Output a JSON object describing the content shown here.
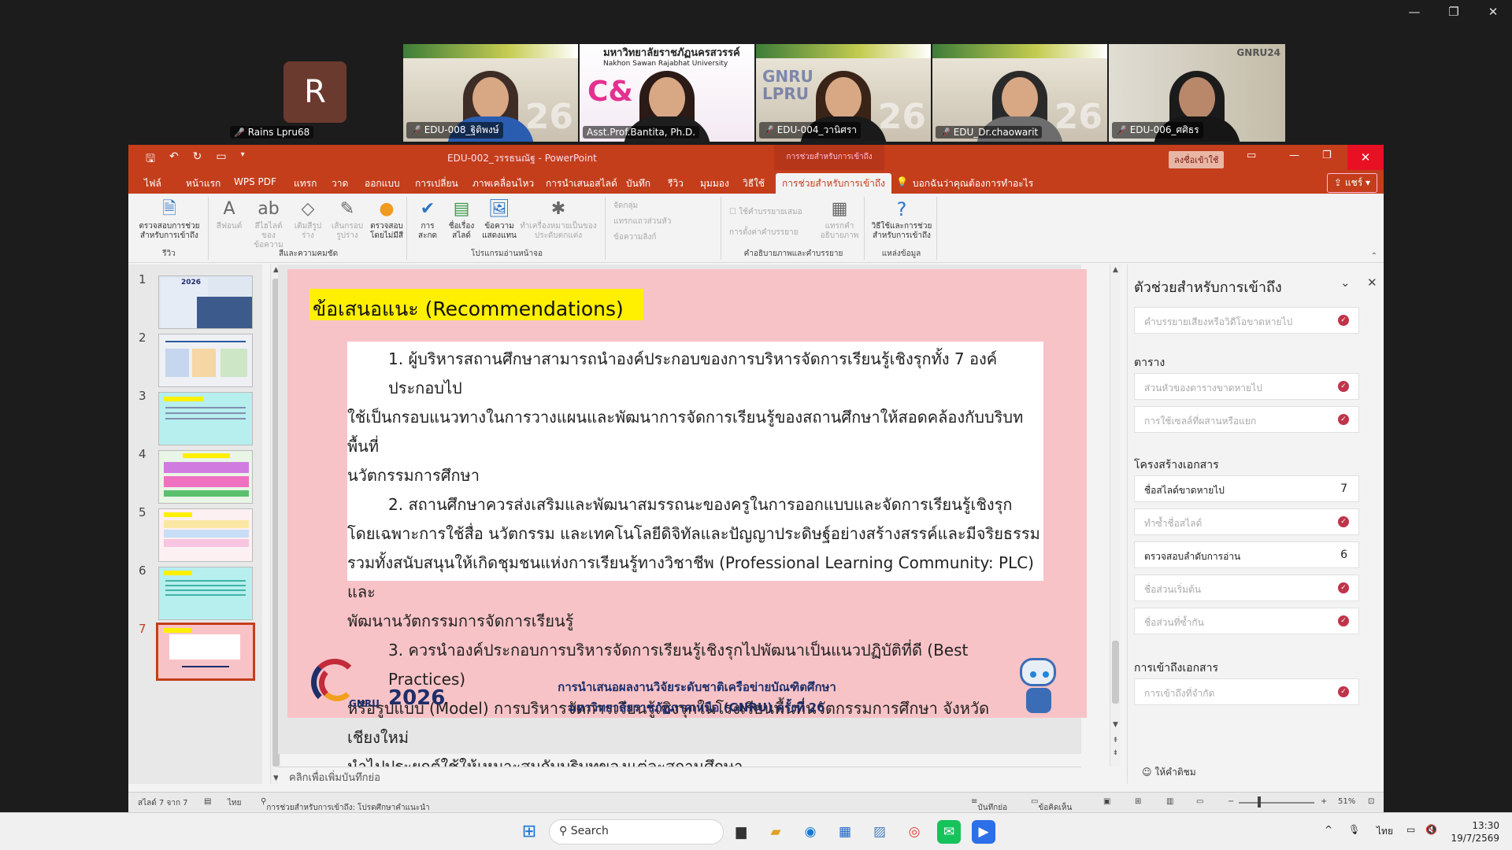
{
  "zoom": {
    "self": {
      "initial": "R",
      "name": "Rains Lpru68"
    },
    "tiles": [
      {
        "name": "EDU-008_ฐิติพงษ์",
        "big": "26"
      },
      {
        "name": "Asst.Prof.Bantita, Ph.D.",
        "banner_title": "มหาวิทยาลัยราชภัฏนครสวรรค์",
        "banner_sub": "Nakhon Sawan Rajabhat University",
        "big": "C&"
      },
      {
        "name": "EDU-004_วานิศรา",
        "big": "26",
        "side": "GNRU LPRU"
      },
      {
        "name": "EDU_Dr.chaowarit",
        "big": "26"
      },
      {
        "name": "EDU-006_ศศิธร",
        "big": "GNRU24"
      }
    ]
  },
  "ppt": {
    "doc_title": "EDU-002_วรรธนณัฐ - PowerPoint",
    "ctx_tab": "การช่วยสำหรับการเข้าถึง",
    "signin": "ลงชื่อเข้าใช้",
    "tabs": [
      "ไฟล์",
      "หน้าแรก",
      "WPS PDF",
      "แทรก",
      "วาด",
      "ออกแบบ",
      "การเปลี่ยน",
      "ภาพเคลื่อนไหว",
      "การนำเสนอสไลด์",
      "บันทึก",
      "รีวิว",
      "มุมมอง",
      "วิธีใช้",
      "การช่วยสำหรับการเข้าถึง"
    ],
    "tellme": "บอกฉันว่าคุณต้องการทำอะไร",
    "share": "แชร์",
    "ribbon": {
      "check": "ตรวจสอบการช่วยสำหรับการเข้าถึง",
      "group_review": "รีวิว",
      "font_color": "สีฟอนต์",
      "text_highlight": "สีไฮไลต์ของข้อความ",
      "fill_color": "เติมสีรูปร่าง",
      "outline": "เส้นกรอบรูปร่าง",
      "auto_check": "ตรวจสอบโดยไม่มีสี",
      "group_color": "สีและความคมชัด",
      "alt_title": "การสะกด",
      "slide_title": "ชื่อเรื่องสไลด์",
      "reading_order": "ข้อความแสดงแทน",
      "mark_decorative": "ทำเครื่องหมายเป็นของประดับตกแต่ง",
      "group_alt": "โปรแกรมอ่านหน้าจอ",
      "table_hdr": "จัดกลุ่ม",
      "link_text": "แทรกแถวส่วนหัว",
      "link_alt": "ข้อความลิงก์",
      "caption": "ใช้คำบรรยายเสมอ",
      "caption_insert": "การตั้งค่าคำบรรยาย",
      "caption_alt": "แทรกคำอธิบายภาพ",
      "group_caption": "คำอธิบายภาพและคำบรรยาย",
      "help": "วิธีใช้และการช่วยสำหรับการเข้าถึง",
      "group_help": "แหล่งข้อมูล"
    },
    "slides_count": 7,
    "current_slide": 7,
    "slide": {
      "title": "ข้อเสนอแนะ (Recommendations)",
      "lines": [
        {
          "text": "1. ผู้บริหารสถานศึกษาสามารถนำองค์ประกอบของการบริหารจัดการเรียนรู้เชิงรุกทั้ง 7 องค์ประกอบไป",
          "indent": true
        },
        {
          "text": "ใช้เป็นกรอบแนวทางในการวางแผนและพัฒนาการจัดการเรียนรู้ของสถานศึกษาให้สอดคล้องกับบริบทพื้นที่",
          "indent": false
        },
        {
          "text": "นวัตกรรมการศึกษา",
          "indent": false
        },
        {
          "text": "2. สถานศึกษาควรส่งเสริมและพัฒนาสมรรถนะของครูในการออกแบบและจัดการเรียนรู้เชิงรุก",
          "indent": true
        },
        {
          "text": "โดยเฉพาะการใช้สื่อ นวัตกรรม และเทคโนโลยีดิจิทัลและปัญญาประดิษฐ์อย่างสร้างสรรค์และมีจริยธรรม",
          "indent": false
        },
        {
          "text": "รวมทั้งสนับสนุนให้เกิดชุมชนแห่งการเรียนรู้ทางวิชาชีพ (Professional Learning Community: PLC) และ",
          "indent": false
        },
        {
          "text": "พัฒนานวัตกรรมการจัดการเรียนรู้",
          "indent": false
        },
        {
          "text": "3. ควรนำองค์ประกอบการบริหารจัดการเรียนรู้เชิงรุกไปพัฒนาเป็นแนวปฏิบัติที่ดี (Best Practices)",
          "indent": true
        },
        {
          "text": "หรือรูปแบบ (Model) การบริหารจัดการเรียนรู้เชิงรุกในโรงเรียนพื้นที่นวัตกรรมการศึกษา จังหวัดเชียงใหม่",
          "indent": false
        },
        {
          "text": "นำไปประยุกต์ใช้ให้เหมาะสมกับบริบทของแต่ละสถานศึกษา",
          "indent": false
        }
      ],
      "logo_text": "GNRU",
      "year": "2026",
      "footer_1": "การนำเสนอผลงานวิจัยระดับชาติเครือข่ายบัณฑิตศึกษา",
      "footer_2": "มหาวิทยาลัยราชภัฏภาคเหนือ (GNRU) ครั้งที่ 26"
    },
    "notes_placeholder": "คลิกเพื่อเพิ่มบันทึกย่อ",
    "pane": {
      "title": "ตัวช่วยสำหรับการเข้าถึง",
      "top_item": "คำบรรยายเสียงหรือวิดีโอขาดหายไป",
      "sec_table": "ตาราง",
      "table_items": [
        "ส่วนหัวของตารางขาดหายไป",
        "การใช้เซลล์ที่ผสานหรือแยก"
      ],
      "sec_struct": "โครงสร้างเอกสาร",
      "struct_items": [
        {
          "label": "ชื่อสไลด์ขาดหายไป",
          "count": "7",
          "active": true
        },
        {
          "label": "ทำซ้ำชื่อสไลด์",
          "count": "",
          "active": false
        },
        {
          "label": "ตรวจสอบลำดับการอ่าน",
          "count": "6",
          "active": true
        },
        {
          "label": "ชื่อส่วนเริ่มต้น",
          "count": "",
          "active": false
        },
        {
          "label": "ชื่อส่วนที่ซ้ำกัน",
          "count": "",
          "active": false
        }
      ],
      "sec_access": "การเข้าถึงเอกสาร",
      "access_item": "การเข้าถึงที่จำกัด",
      "footer": "ให้คำติชม"
    },
    "status": {
      "slide_pos": "สไลด์ 7 จาก 7",
      "lang": "ไทย",
      "a11y": "การช่วยสำหรับการเข้าถึง: โปรดศึกษาคำแนะนำ",
      "notes": "บันทึกย่อ",
      "comments": "ข้อคิดเห็น",
      "zoom": "51%"
    }
  },
  "taskbar": {
    "search": "Search",
    "lang": "ไทย",
    "time": "13:30",
    "date": "19/7/2569"
  }
}
